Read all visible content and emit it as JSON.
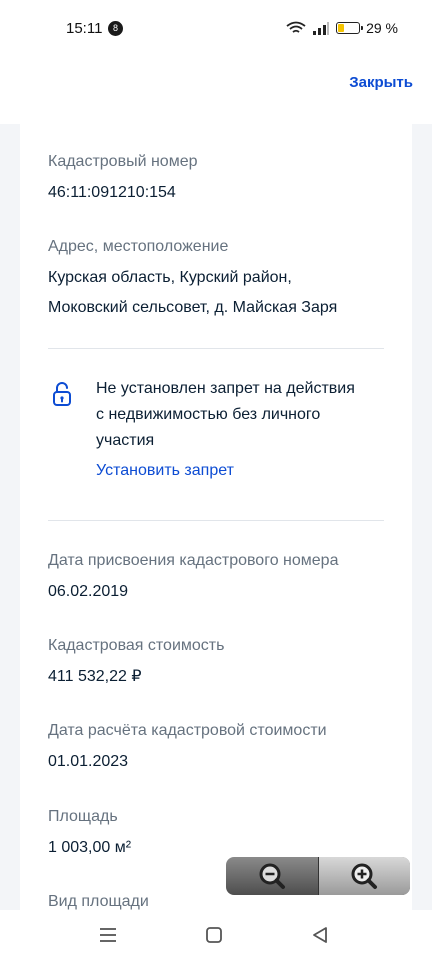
{
  "status_bar": {
    "time": "15:11",
    "notification_count": "8",
    "battery_percent": "29 %",
    "battery_level": 0.29
  },
  "header": {
    "close_label": "Закрыть"
  },
  "property": {
    "cadastral_number_label": "Кадастровый номер",
    "cadastral_number": "46:11:091210:154",
    "address_label": "Адрес, местоположение",
    "address_line1": "Курская область, Курский район,",
    "address_line2": "Моковский сельсовет, д. Майская Заря",
    "restriction_line1": "Не установлен запрет на действия",
    "restriction_line2": "с недвижимостью без личного",
    "restriction_line3": "участия",
    "restriction_action": "Установить запрет",
    "assignment_date_label": "Дата присвоения кадастрового номера",
    "assignment_date": "06.02.2019",
    "cadastral_value_label": "Кадастровая стоимость",
    "cadastral_value": "411 532,22 ₽",
    "value_calc_date_label": "Дата расчёта кадастровой стоимости",
    "value_calc_date": "01.01.2023",
    "area_label": "Площадь",
    "area": "1 003,00 м²",
    "area_type_label": "Вид площади"
  },
  "colors": {
    "accent": "#0d4cd3",
    "label": "#66727f",
    "text": "#0b1f33",
    "background": "#f3f5f8"
  },
  "icons": [
    "notification-badge",
    "wifi-icon",
    "signal-icon",
    "battery-icon",
    "unlock-icon",
    "zoom-out-icon",
    "zoom-in-icon",
    "recents-icon",
    "home-icon",
    "back-icon"
  ]
}
